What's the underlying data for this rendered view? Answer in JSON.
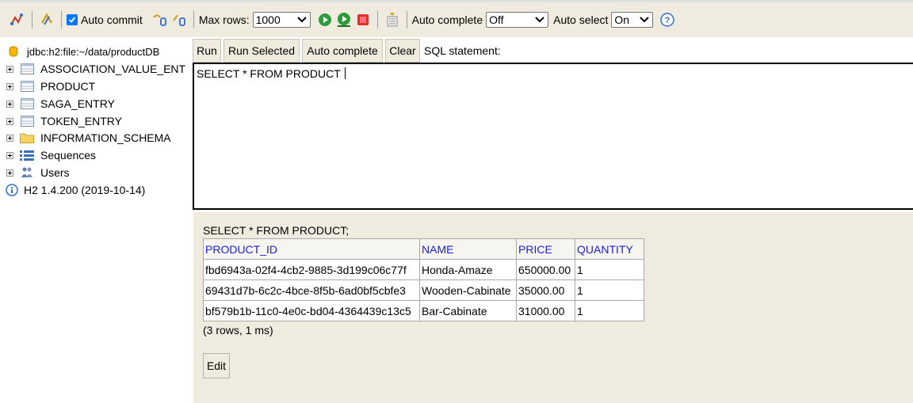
{
  "toolbar": {
    "auto_commit_label": "Auto commit",
    "auto_commit_checked": true,
    "max_rows_label": "Max rows:",
    "max_rows_value": "1000",
    "auto_complete_label": "Auto complete",
    "auto_complete_value": "Off",
    "auto_select_label": "Auto select",
    "auto_select_value": "On",
    "icons": [
      "disconnect-icon",
      "refresh-icon",
      "rollback-icon",
      "commit-icon",
      "run-icon",
      "run-selected-icon",
      "stop-icon",
      "history-icon",
      "help-icon"
    ]
  },
  "tree": {
    "connection": "jdbc:h2:file:~/data/productDB",
    "items": [
      {
        "label": "ASSOCIATION_VALUE_ENT",
        "icon": "table-icon"
      },
      {
        "label": "PRODUCT",
        "icon": "table-icon"
      },
      {
        "label": "SAGA_ENTRY",
        "icon": "table-icon"
      },
      {
        "label": "TOKEN_ENTRY",
        "icon": "table-icon"
      },
      {
        "label": "INFORMATION_SCHEMA",
        "icon": "folder-icon"
      },
      {
        "label": "Sequences",
        "icon": "sequences-icon"
      },
      {
        "label": "Users",
        "icon": "users-icon"
      }
    ],
    "version": "H2 1.4.200 (2019-10-14)"
  },
  "buttons": {
    "run": "Run",
    "run_selected": "Run Selected",
    "auto_complete": "Auto complete",
    "clear": "Clear",
    "sql_statement_label": "SQL statement:"
  },
  "editor": {
    "text": "SELECT * FROM PRODUCT "
  },
  "result": {
    "query": "SELECT * FROM PRODUCT;",
    "columns": [
      "PRODUCT_ID",
      "NAME",
      "PRICE",
      "QUANTITY"
    ],
    "rows": [
      [
        "fbd6943a-02f4-4cb2-9885-3d199c06c77f",
        "Honda-Amaze",
        "650000.00",
        "1"
      ],
      [
        "69431d7b-6c2c-4bce-8f5b-6ad0bf5cbfe3",
        "Wooden-Cabinate",
        "35000.00",
        "1"
      ],
      [
        "bf579b1b-11c0-4e0c-bd04-4364439c13c5",
        "Bar-Cabinate",
        "31000.00",
        "1"
      ]
    ],
    "summary": "(3 rows, 1 ms)",
    "edit_label": "Edit"
  },
  "colors": {
    "toolbar_bg": "#efebde",
    "header_link": "#1a1aee",
    "checkbox_accent": "#0075ff"
  }
}
